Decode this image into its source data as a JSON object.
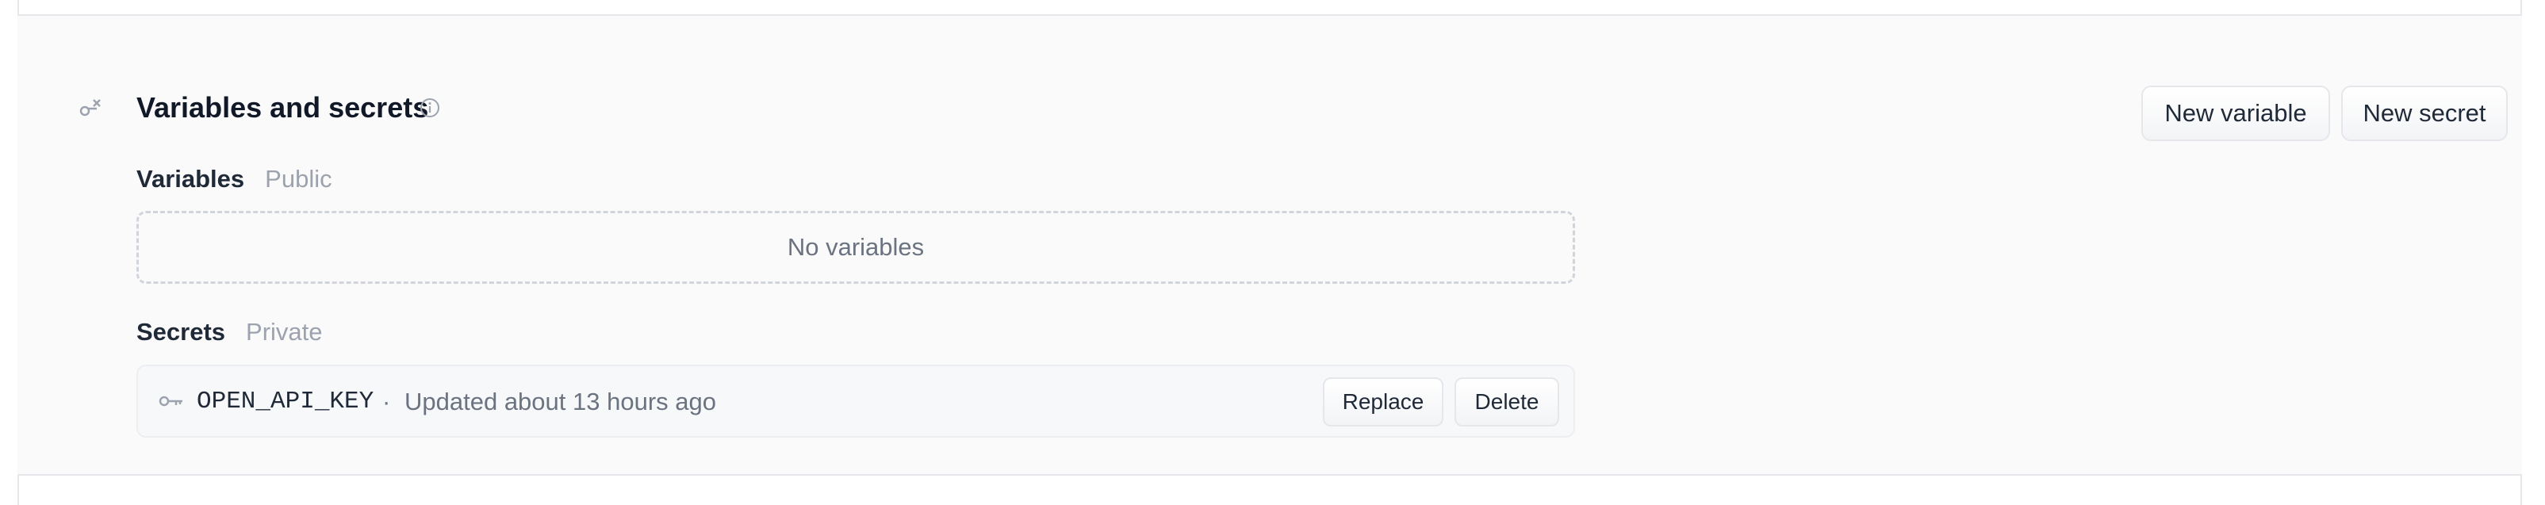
{
  "section": {
    "title": "Variables and secrets",
    "icon": "key-icon",
    "info_icon": "info-icon"
  },
  "toolbar": {
    "new_variable_label": "New variable",
    "new_secret_label": "New secret"
  },
  "variables": {
    "heading": "Variables",
    "visibility": "Public",
    "empty_text": "No variables",
    "items": []
  },
  "secrets": {
    "heading": "Secrets",
    "visibility": "Private",
    "items": [
      {
        "name": "OPEN_API_KEY",
        "separator": "·",
        "updated": "Updated about 13 hours ago",
        "replace_label": "Replace",
        "delete_label": "Delete"
      }
    ]
  },
  "colors": {
    "background": "#fafafa",
    "border": "#e5e7eb",
    "text": "#111827",
    "muted": "#9ca3af"
  }
}
